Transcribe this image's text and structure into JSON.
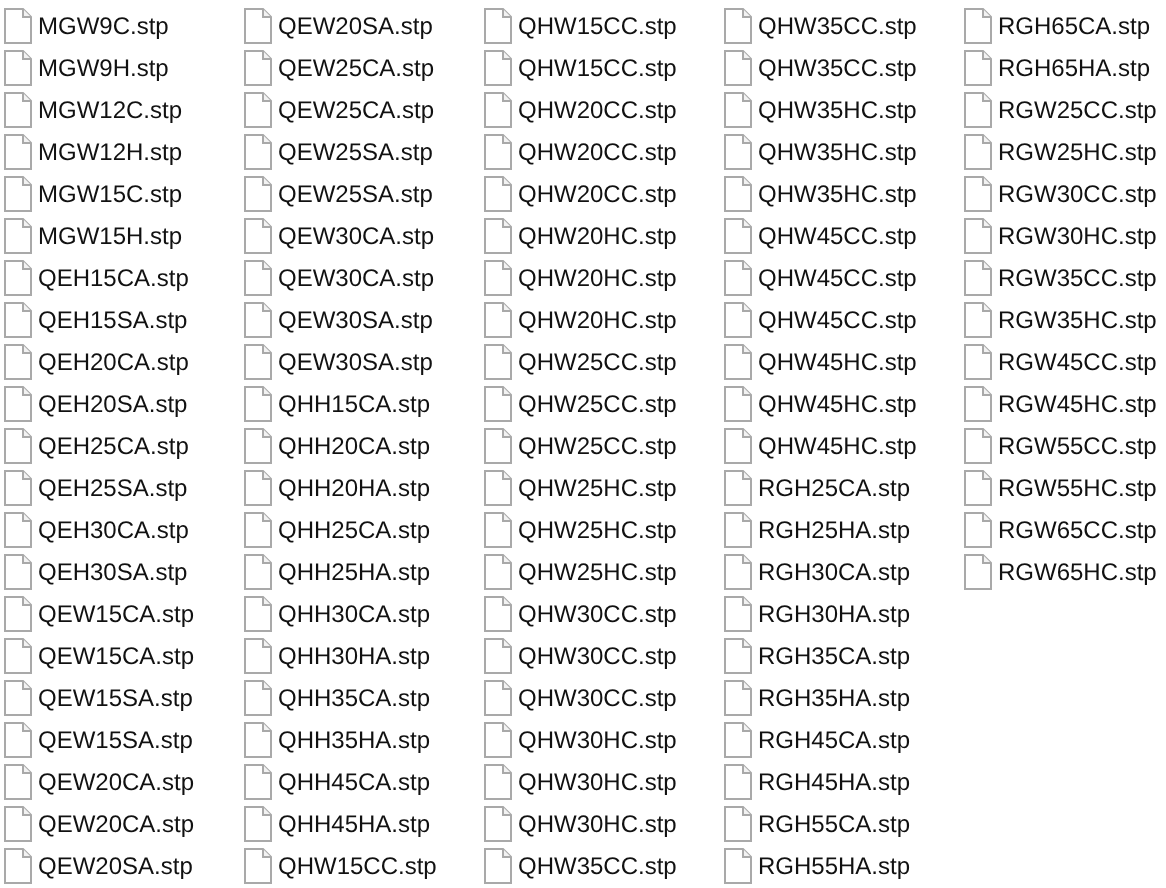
{
  "files": [
    {
      "name": "MGW9C.stp"
    },
    {
      "name": "MGW9H.stp"
    },
    {
      "name": "MGW12C.stp"
    },
    {
      "name": "MGW12H.stp"
    },
    {
      "name": "MGW15C.stp"
    },
    {
      "name": "MGW15H.stp"
    },
    {
      "name": "QEH15CA.stp"
    },
    {
      "name": "QEH15SA.stp"
    },
    {
      "name": "QEH20CA.stp"
    },
    {
      "name": "QEH20SA.stp"
    },
    {
      "name": "QEH25CA.stp"
    },
    {
      "name": "QEH25SA.stp"
    },
    {
      "name": "QEH30CA.stp"
    },
    {
      "name": "QEH30SA.stp"
    },
    {
      "name": "QEW15CA.stp"
    },
    {
      "name": "QEW15CA.stp"
    },
    {
      "name": "QEW15SA.stp"
    },
    {
      "name": "QEW15SA.stp"
    },
    {
      "name": "QEW20CA.stp"
    },
    {
      "name": "QEW20CA.stp"
    },
    {
      "name": "QEW20SA.stp"
    },
    {
      "name": "QEW20SA.stp"
    },
    {
      "name": "QEW25CA.stp"
    },
    {
      "name": "QEW25CA.stp"
    },
    {
      "name": "QEW25SA.stp"
    },
    {
      "name": "QEW25SA.stp"
    },
    {
      "name": "QEW30CA.stp"
    },
    {
      "name": "QEW30CA.stp"
    },
    {
      "name": "QEW30SA.stp"
    },
    {
      "name": "QEW30SA.stp"
    },
    {
      "name": "QHH15CA.stp"
    },
    {
      "name": "QHH20CA.stp"
    },
    {
      "name": "QHH20HA.stp"
    },
    {
      "name": "QHH25CA.stp"
    },
    {
      "name": "QHH25HA.stp"
    },
    {
      "name": "QHH30CA.stp"
    },
    {
      "name": "QHH30HA.stp"
    },
    {
      "name": "QHH35CA.stp"
    },
    {
      "name": "QHH35HA.stp"
    },
    {
      "name": "QHH45CA.stp"
    },
    {
      "name": "QHH45HA.stp"
    },
    {
      "name": "QHW15CC.stp"
    },
    {
      "name": "QHW15CC.stp"
    },
    {
      "name": "QHW15CC.stp"
    },
    {
      "name": "QHW20CC.stp"
    },
    {
      "name": "QHW20CC.stp"
    },
    {
      "name": "QHW20CC.stp"
    },
    {
      "name": "QHW20HC.stp"
    },
    {
      "name": "QHW20HC.stp"
    },
    {
      "name": "QHW20HC.stp"
    },
    {
      "name": "QHW25CC.stp"
    },
    {
      "name": "QHW25CC.stp"
    },
    {
      "name": "QHW25CC.stp"
    },
    {
      "name": "QHW25HC.stp"
    },
    {
      "name": "QHW25HC.stp"
    },
    {
      "name": "QHW25HC.stp"
    },
    {
      "name": "QHW30CC.stp"
    },
    {
      "name": "QHW30CC.stp"
    },
    {
      "name": "QHW30CC.stp"
    },
    {
      "name": "QHW30HC.stp"
    },
    {
      "name": "QHW30HC.stp"
    },
    {
      "name": "QHW30HC.stp"
    },
    {
      "name": "QHW35CC.stp"
    },
    {
      "name": "QHW35CC.stp"
    },
    {
      "name": "QHW35CC.stp"
    },
    {
      "name": "QHW35HC.stp"
    },
    {
      "name": "QHW35HC.stp"
    },
    {
      "name": "QHW35HC.stp"
    },
    {
      "name": "QHW45CC.stp"
    },
    {
      "name": "QHW45CC.stp"
    },
    {
      "name": "QHW45CC.stp"
    },
    {
      "name": "QHW45HC.stp"
    },
    {
      "name": "QHW45HC.stp"
    },
    {
      "name": "QHW45HC.stp"
    },
    {
      "name": "RGH25CA.stp"
    },
    {
      "name": "RGH25HA.stp"
    },
    {
      "name": "RGH30CA.stp"
    },
    {
      "name": "RGH30HA.stp"
    },
    {
      "name": "RGH35CA.stp"
    },
    {
      "name": "RGH35HA.stp"
    },
    {
      "name": "RGH45CA.stp"
    },
    {
      "name": "RGH45HA.stp"
    },
    {
      "name": "RGH55CA.stp"
    },
    {
      "name": "RGH55HA.stp"
    },
    {
      "name": "RGH65CA.stp"
    },
    {
      "name": "RGH65HA.stp"
    },
    {
      "name": "RGW25CC.stp"
    },
    {
      "name": "RGW25HC.stp"
    },
    {
      "name": "RGW30CC.stp"
    },
    {
      "name": "RGW30HC.stp"
    },
    {
      "name": "RGW35CC.stp"
    },
    {
      "name": "RGW35HC.stp"
    },
    {
      "name": "RGW45CC.stp"
    },
    {
      "name": "RGW45HC.stp"
    },
    {
      "name": "RGW55CC.stp"
    },
    {
      "name": "RGW55HC.stp"
    },
    {
      "name": "RGW65CC.stp"
    },
    {
      "name": "RGW65HC.stp"
    }
  ]
}
